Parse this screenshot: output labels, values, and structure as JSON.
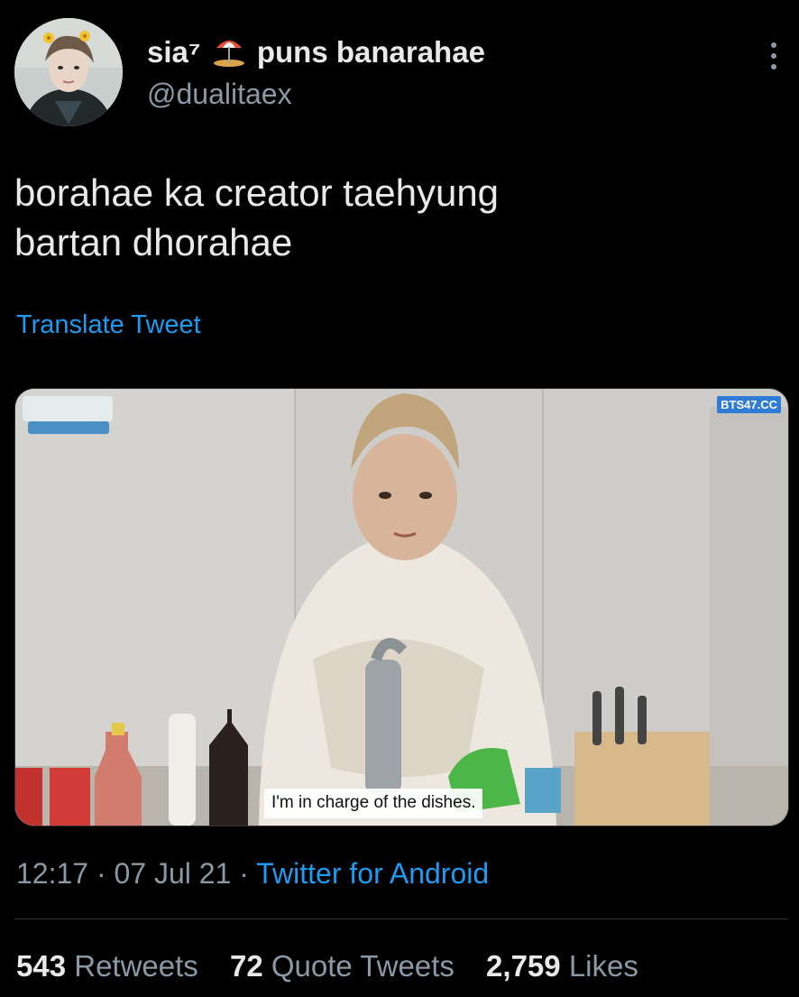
{
  "user": {
    "display_name_part1": "sia⁷",
    "display_name_part2": "puns banarahae",
    "handle": "@dualitaex",
    "emoji_icon": "umbrella-on-ground-icon"
  },
  "tweet": {
    "text": "borahae ka creator taehyung\nbartan dhorahae",
    "translate_label": "Translate Tweet"
  },
  "media": {
    "caption": "I'm in charge of the dishes.",
    "watermark_right": "BTS47.CC"
  },
  "meta": {
    "time": "12:17",
    "sep1": " · ",
    "date": "07 Jul 21",
    "sep2": " · ",
    "source": "Twitter for Android"
  },
  "stats": {
    "retweets_count": "543",
    "retweets_label": "Retweets",
    "quotes_count": "72",
    "quotes_label": "Quote Tweets",
    "likes_count": "2,759",
    "likes_label": "Likes"
  },
  "colors": {
    "background": "#000000",
    "text": "#e7e9ea",
    "secondary": "#8b98a5",
    "link": "#1d9bf0",
    "divider": "#2f3336"
  }
}
